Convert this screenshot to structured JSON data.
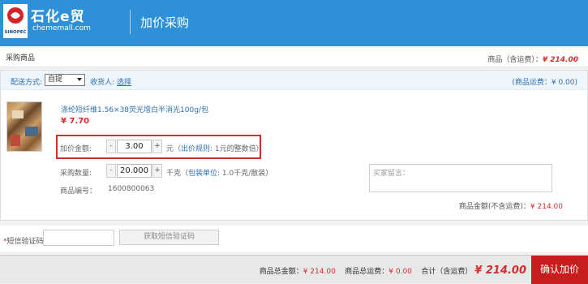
{
  "header": {
    "logo_text": "石化e贸",
    "logo_domain": "chememall.com",
    "logo_brand": "SINOPEC",
    "page_title": "加价采购",
    "bg_color": "#2e90d6"
  },
  "summary": {
    "section_title": "采购商品",
    "total_label": "商品（含运费）：",
    "total_value": "¥ 214.00"
  },
  "shipping": {
    "method_label": "配送方式:",
    "method_value": "自提",
    "receiver_label": "收货人:",
    "receiver_link": "选择",
    "fee_text": "(商品运费：¥ 0.00)"
  },
  "product": {
    "name": "涤纶短纤维1.56×38荧光增白半消光100g/包",
    "price": "¥ 7.70",
    "markup": {
      "label": "加价金额:",
      "minus": "-",
      "value": "3.00",
      "plus": "+",
      "unit": "元（",
      "rule_link": "出价规则",
      "rule_text": ": 1元的整数倍）"
    },
    "quantity": {
      "label": "采购数量:",
      "minus": "-",
      "value": "20.000",
      "plus": "+",
      "unit": "千克（",
      "package_link": "包装单位",
      "package_text": ": 1.0千克/散装）"
    },
    "code_label": "商品编号：",
    "code_value": "1600800063",
    "message_placeholder": "买家留言：",
    "amount_label": "商品金额(不含运费)：",
    "amount_value": "¥ 214.00"
  },
  "sms": {
    "label": "短信验证码：",
    "required_mark": "*",
    "button": "获取短信验证码"
  },
  "footer": {
    "goods_total_label": "商品总金额：",
    "goods_total_value": "¥ 214.00",
    "freight_label": "商品总运费：",
    "freight_value": "¥ 0.00",
    "grand_label": "合计（含运费）",
    "grand_value": "¥ 214.00",
    "confirm": "确认加价",
    "accent_color": "#c81d1d"
  }
}
